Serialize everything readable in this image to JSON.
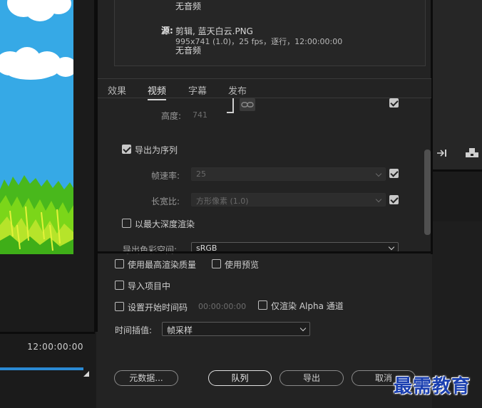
{
  "preview": {
    "timecode": "12:00:00:00"
  },
  "summary": {
    "no_audio_top": "无音频",
    "source_label": "源:",
    "source_line": "剪辑, 蓝天白云.PNG",
    "source_details": "995x741 (1.0)，25 fps，逐行，12:00:00:00",
    "no_audio_bottom": "无音频"
  },
  "tabs": [
    {
      "label": "效果",
      "active": false
    },
    {
      "label": "视频",
      "active": true
    },
    {
      "label": "字幕",
      "active": false
    },
    {
      "label": "发布",
      "active": false
    }
  ],
  "video": {
    "height_label": "高度:",
    "height_value": "741",
    "export_sequence_label": "导出为序列",
    "export_sequence_checked": true,
    "frame_rate_label": "帧速率:",
    "frame_rate_value": "25",
    "frame_rate_match_checked": true,
    "aspect_label": "长宽比:",
    "aspect_value": "方形像素 (1.0)",
    "aspect_match_checked": true,
    "max_depth_label": "以最大深度渲染",
    "max_depth_checked": false,
    "color_space_label": "导出色彩空间:",
    "color_space_value": "sRGB",
    "link_checked": true
  },
  "options": {
    "max_quality_label": "使用最高渲染质量",
    "use_preview_label": "使用预览",
    "import_project_label": "导入项目中",
    "set_timecode_label": "设置开始时间码",
    "timecode_value": "00:00:00:00",
    "alpha_only_label": "仅渲染 Alpha 通道",
    "interp_label": "时间插值:",
    "interp_value": "帧采样"
  },
  "buttons": {
    "metadata": "元数据...",
    "queue": "队列",
    "export": "导出",
    "cancel": "取消"
  },
  "watermark": "最需教育"
}
